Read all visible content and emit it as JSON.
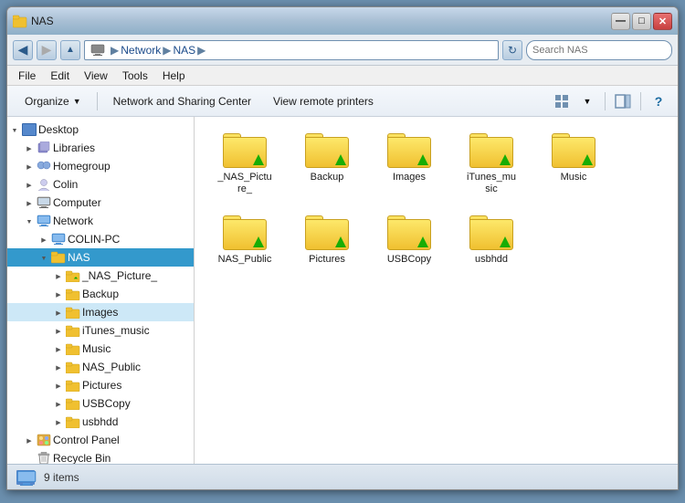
{
  "window": {
    "title": "NAS",
    "controls": {
      "minimize": "—",
      "maximize": "□",
      "close": "✕"
    }
  },
  "addressbar": {
    "path_parts": [
      "Network",
      "NAS"
    ],
    "search_placeholder": "Search NAS"
  },
  "menu": {
    "items": [
      "File",
      "Edit",
      "View",
      "Tools",
      "Help"
    ]
  },
  "toolbar": {
    "organize": "Organize",
    "organize_arrow": "▼",
    "network_sharing": "Network and Sharing Center",
    "view_remote": "View remote printers"
  },
  "tree": {
    "items": [
      {
        "label": "Desktop",
        "level": 0,
        "expanded": true,
        "type": "desktop"
      },
      {
        "label": "Libraries",
        "level": 1,
        "expanded": false,
        "type": "library"
      },
      {
        "label": "Homegroup",
        "level": 1,
        "expanded": false,
        "type": "homegroup"
      },
      {
        "label": "Colin",
        "level": 1,
        "expanded": false,
        "type": "user"
      },
      {
        "label": "Computer",
        "level": 1,
        "expanded": false,
        "type": "computer"
      },
      {
        "label": "Network",
        "level": 1,
        "expanded": true,
        "type": "network"
      },
      {
        "label": "COLIN-PC",
        "level": 2,
        "expanded": false,
        "type": "pc"
      },
      {
        "label": "NAS",
        "level": 2,
        "expanded": true,
        "type": "nas",
        "selected": true
      },
      {
        "label": "_NAS_Picture_",
        "level": 3,
        "expanded": false,
        "type": "folder"
      },
      {
        "label": "Backup",
        "level": 3,
        "expanded": false,
        "type": "folder"
      },
      {
        "label": "Images",
        "level": 3,
        "expanded": false,
        "type": "folder",
        "highlighted": true
      },
      {
        "label": "iTunes_music",
        "level": 3,
        "expanded": false,
        "type": "folder"
      },
      {
        "label": "Music",
        "level": 3,
        "expanded": false,
        "type": "folder"
      },
      {
        "label": "NAS_Public",
        "level": 3,
        "expanded": false,
        "type": "folder"
      },
      {
        "label": "Pictures",
        "level": 3,
        "expanded": false,
        "type": "folder"
      },
      {
        "label": "USBCopy",
        "level": 3,
        "expanded": false,
        "type": "folder"
      },
      {
        "label": "usbhdd",
        "level": 3,
        "expanded": false,
        "type": "folder"
      },
      {
        "label": "Control Panel",
        "level": 1,
        "expanded": false,
        "type": "control_panel"
      },
      {
        "label": "Recycle Bin",
        "level": 1,
        "expanded": false,
        "type": "recycle"
      }
    ]
  },
  "content": {
    "folders": [
      {
        "name": "_NAS_Pictu\nre_",
        "shared": true
      },
      {
        "name": "Backup",
        "shared": true
      },
      {
        "name": "Images",
        "shared": true
      },
      {
        "name": "iTunes_mu\nsic",
        "shared": true
      },
      {
        "name": "Music",
        "shared": true
      },
      {
        "name": "NAS_Public",
        "shared": true
      },
      {
        "name": "Pictures",
        "shared": true
      },
      {
        "name": "USBCopy",
        "shared": true
      },
      {
        "name": "usbhdd",
        "shared": true
      }
    ]
  },
  "statusbar": {
    "count": "9 items"
  }
}
